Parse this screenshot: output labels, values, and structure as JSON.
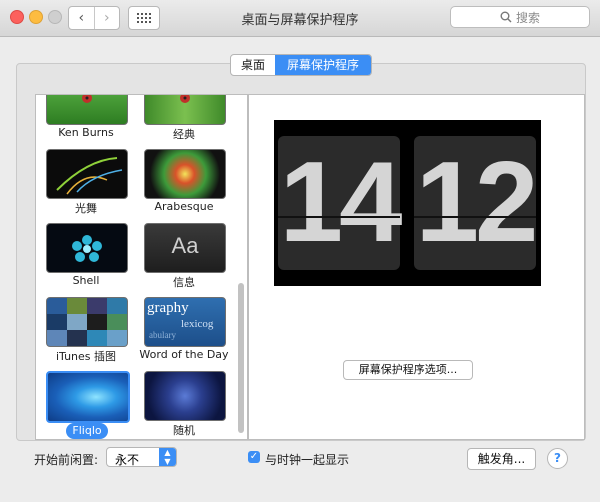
{
  "window": {
    "title": "桌面与屏幕保护程序",
    "search_placeholder": "搜索",
    "nav_back": "‹",
    "nav_forward": "›"
  },
  "tabs": [
    {
      "label": "桌面",
      "active": false
    },
    {
      "label": "屏幕保护程序",
      "active": true
    }
  ],
  "screensavers": [
    {
      "label": "Ken Burns",
      "selected": false
    },
    {
      "label": "经典",
      "selected": false
    },
    {
      "label": "光舞",
      "selected": false
    },
    {
      "label": "Arabesque",
      "selected": false
    },
    {
      "label": "Shell",
      "selected": false
    },
    {
      "label": "信息",
      "selected": false,
      "thumb_text": "Aa"
    },
    {
      "label": "iTunes 插图",
      "selected": false
    },
    {
      "label": "Word of the Day",
      "selected": false,
      "thumb_text": "graphy",
      "thumb_text2": "lexicog",
      "thumb_text3": "abulary"
    },
    {
      "label": "Fliqlo",
      "selected": true
    },
    {
      "label": "随机",
      "selected": false
    }
  ],
  "preview": {
    "hours": "14",
    "minutes": "12",
    "options_button": "屏幕保护程序选项..."
  },
  "bottom": {
    "start_after_label": "开始前闲置:",
    "start_after_value": "永不",
    "show_clock_label": "与时钟一起显示",
    "show_clock_checked": true,
    "hot_corners_button": "触发角...",
    "help": "?"
  },
  "colors": {
    "accent": "#3b8ef5"
  }
}
